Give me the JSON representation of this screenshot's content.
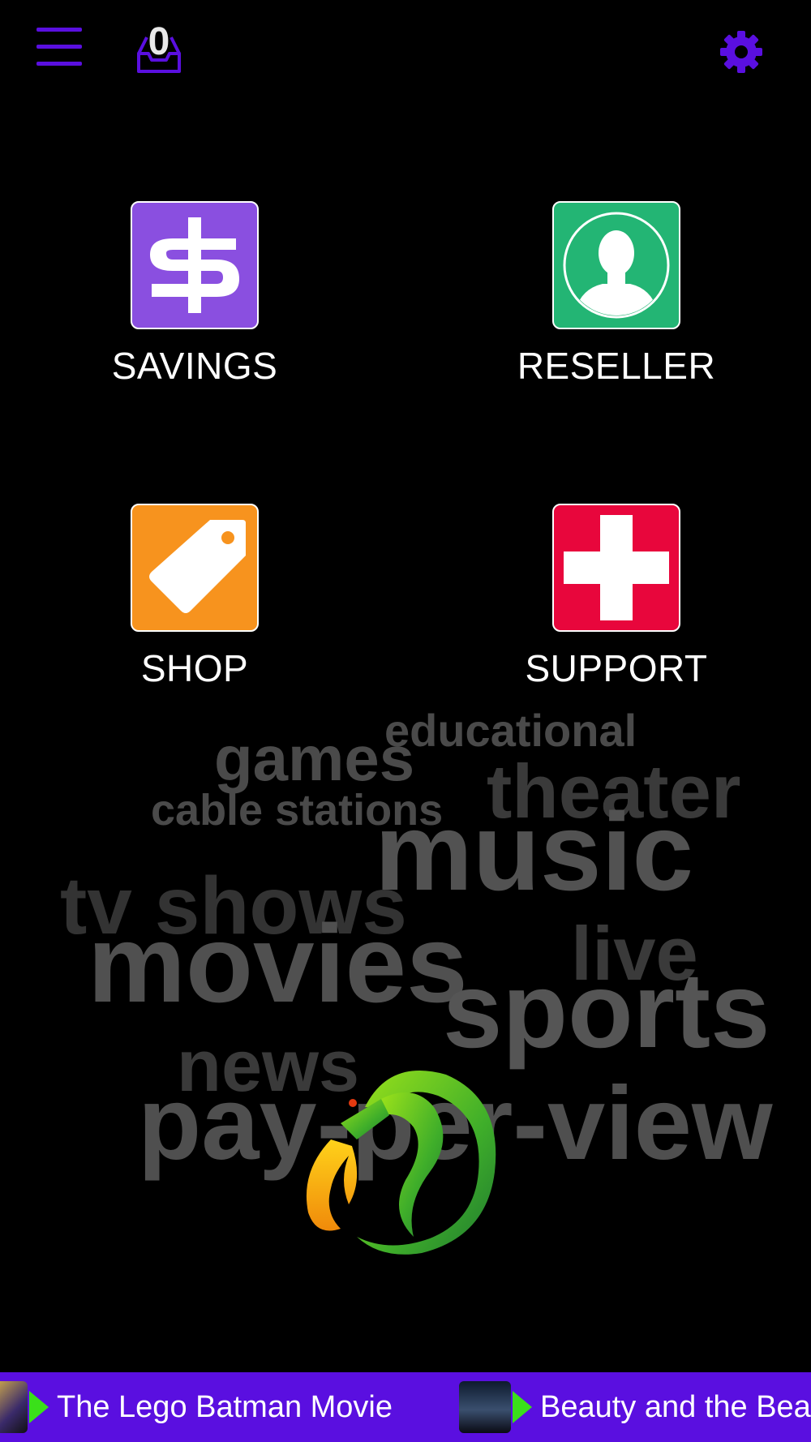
{
  "header": {
    "inbox_count": "0"
  },
  "tiles": [
    {
      "label": "SAVINGS",
      "icon": "dollar-icon",
      "color": "#8a4fe0"
    },
    {
      "label": "RESELLER",
      "icon": "person-icon",
      "color": "#23b574"
    },
    {
      "label": "SHOP",
      "icon": "tag-icon",
      "color": "#f7931e"
    },
    {
      "label": "SUPPORT",
      "icon": "cross-icon",
      "color": "#e8063c"
    }
  ],
  "word_cloud": [
    "educational",
    "games",
    "theater",
    "cable stations",
    "music",
    "tv shows",
    "movies",
    "live",
    "sports",
    "news",
    "pay-per-view"
  ],
  "ticker": {
    "items": [
      {
        "title": "The Lego Batman Movie"
      },
      {
        "title": "Beauty and the Beast"
      }
    ]
  },
  "colors": {
    "accent": "#5a0fe0",
    "background": "#000000",
    "play": "#3ae01a"
  }
}
